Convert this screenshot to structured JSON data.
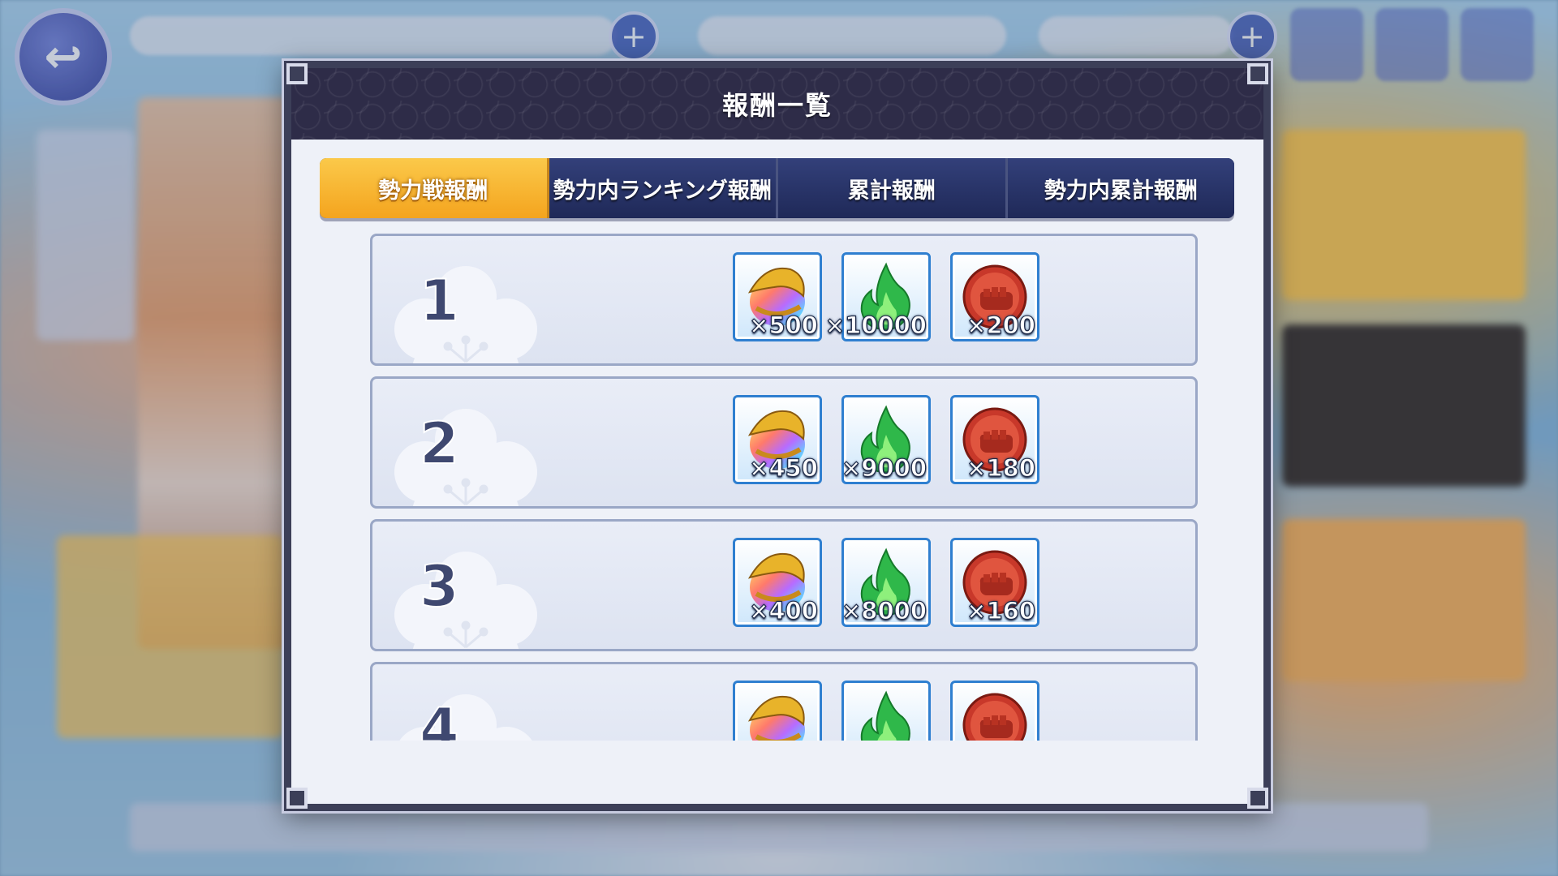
{
  "modal": {
    "title": "報酬一覧",
    "tabs": [
      {
        "label": "勢力戦報酬",
        "active": true
      },
      {
        "label": "勢力内ランキング報酬",
        "active": false
      },
      {
        "label": "累計報酬",
        "active": false
      },
      {
        "label": "勢力内累計報酬",
        "active": false
      }
    ]
  },
  "rewards": [
    {
      "rank": "1",
      "items": [
        {
          "icon": "rainbow-orb-icon",
          "qty": "×500"
        },
        {
          "icon": "green-flame-icon",
          "qty": "×10000"
        },
        {
          "icon": "red-fist-medal-icon",
          "qty": "×200"
        }
      ]
    },
    {
      "rank": "2",
      "items": [
        {
          "icon": "rainbow-orb-icon",
          "qty": "×450"
        },
        {
          "icon": "green-flame-icon",
          "qty": "×9000"
        },
        {
          "icon": "red-fist-medal-icon",
          "qty": "×180"
        }
      ]
    },
    {
      "rank": "3",
      "items": [
        {
          "icon": "rainbow-orb-icon",
          "qty": "×400"
        },
        {
          "icon": "green-flame-icon",
          "qty": "×8000"
        },
        {
          "icon": "red-fist-medal-icon",
          "qty": "×160"
        }
      ]
    },
    {
      "rank": "4",
      "items": [
        {
          "icon": "rainbow-orb-icon",
          "qty": ""
        },
        {
          "icon": "green-flame-icon",
          "qty": ""
        },
        {
          "icon": "red-fist-medal-icon",
          "qty": ""
        }
      ]
    }
  ],
  "colors": {
    "active_tab": "#f4a41e",
    "inactive_tab": "#24306a",
    "header": "#2e2c48",
    "item_border": "#2f7fd0"
  }
}
